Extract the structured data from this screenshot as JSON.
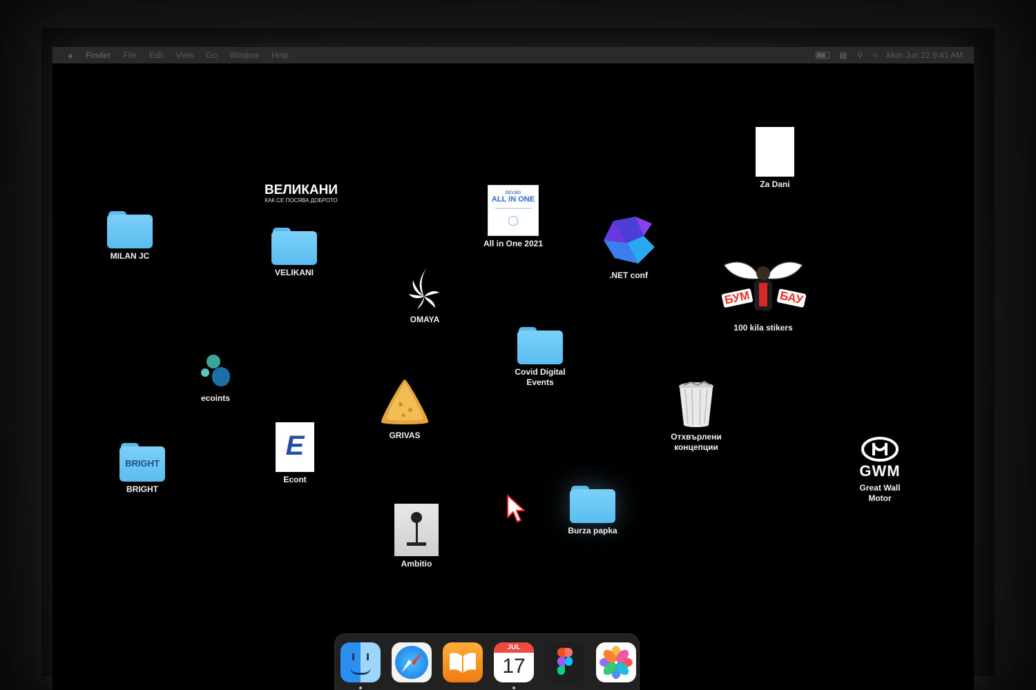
{
  "menubar": {
    "app": "Finder",
    "menus": [
      "File",
      "Edit",
      "View",
      "Go",
      "Window",
      "Help"
    ],
    "clock": "Mon Jun 22  9:41 AM"
  },
  "desktop": {
    "velikani_banner": {
      "title": "ВЕЛИКАНИ",
      "subtitle": "КАК СЕ ПОСЯВА ДОБРОТО"
    },
    "allinone_thumb": {
      "top": "DEV.BG",
      "title": "ALL IN ONE"
    },
    "bright_thumb": "BRIGHT",
    "econt_letter": "E",
    "gwm_logo": "GWM",
    "items": {
      "za_dani": "Za Dani",
      "milan_jc": "MILAN JC",
      "velikani": "VELIKANI",
      "all_in_one": "All in One 2021",
      "net_conf": ".NET conf",
      "omaya": "OMAYA",
      "stickers": "100 kila stikers",
      "covid": "Covid Digital\nEvents",
      "ecoints": "ecoints",
      "grivas": "GRIVAS",
      "otkh": "Отхвърлени\nконцепции",
      "bright": "BRIGHT",
      "econt": "Econt",
      "gwm": "Great Wall\nMotor",
      "ambitio": "Ambitio",
      "burza": "Burza papka"
    },
    "sticker_words": {
      "left": "БУМ",
      "right": "БАУ"
    }
  },
  "dock": {
    "calendar_month": "JUL",
    "calendar_day": "17",
    "apps": [
      "finder-icon",
      "safari-icon",
      "books-icon",
      "calendar-icon",
      "figma-icon",
      "photos-icon"
    ]
  },
  "colors": {
    "folder": "#66c3f2",
    "accent": "#1e8ff5"
  }
}
